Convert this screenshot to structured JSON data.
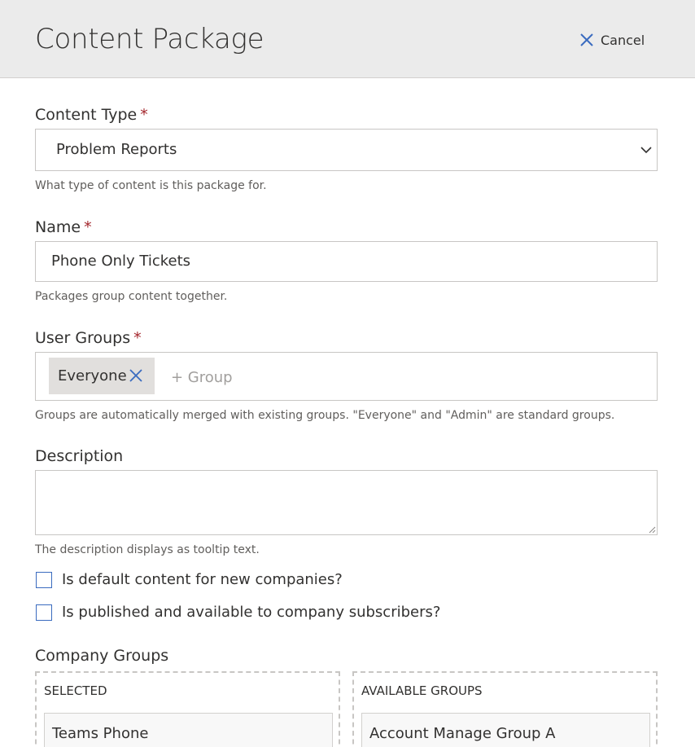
{
  "header": {
    "title": "Content Package",
    "cancel_label": "Cancel"
  },
  "content_type": {
    "label": "Content Type",
    "required_mark": "*",
    "value": "Problem Reports",
    "help": "What type of content is this package for."
  },
  "name": {
    "label": "Name",
    "required_mark": "*",
    "value": "Phone Only Tickets",
    "help": "Packages group content together."
  },
  "user_groups": {
    "label": "User Groups",
    "required_mark": "*",
    "chips": [
      "Everyone"
    ],
    "add_placeholder": "+ Group",
    "help": "Groups are automatically merged with existing groups. \"Everyone\" and \"Admin\" are standard groups."
  },
  "description": {
    "label": "Description",
    "value": "",
    "help": "The description displays as tooltip text."
  },
  "checkboxes": [
    {
      "label": "Is default content for new companies?",
      "checked": false
    },
    {
      "label": "Is published and available to company subscribers?",
      "checked": false
    }
  ],
  "company_groups": {
    "label": "Company Groups",
    "selected": {
      "title": "SELECTED",
      "items": [
        "Teams Phone"
      ]
    },
    "available": {
      "title": "AVAILABLE GROUPS",
      "items": [
        "Account Manage Group A"
      ]
    }
  },
  "colors": {
    "header_bg": "#ebebeb",
    "accent": "#3a6bbf",
    "required": "#a4262c"
  }
}
